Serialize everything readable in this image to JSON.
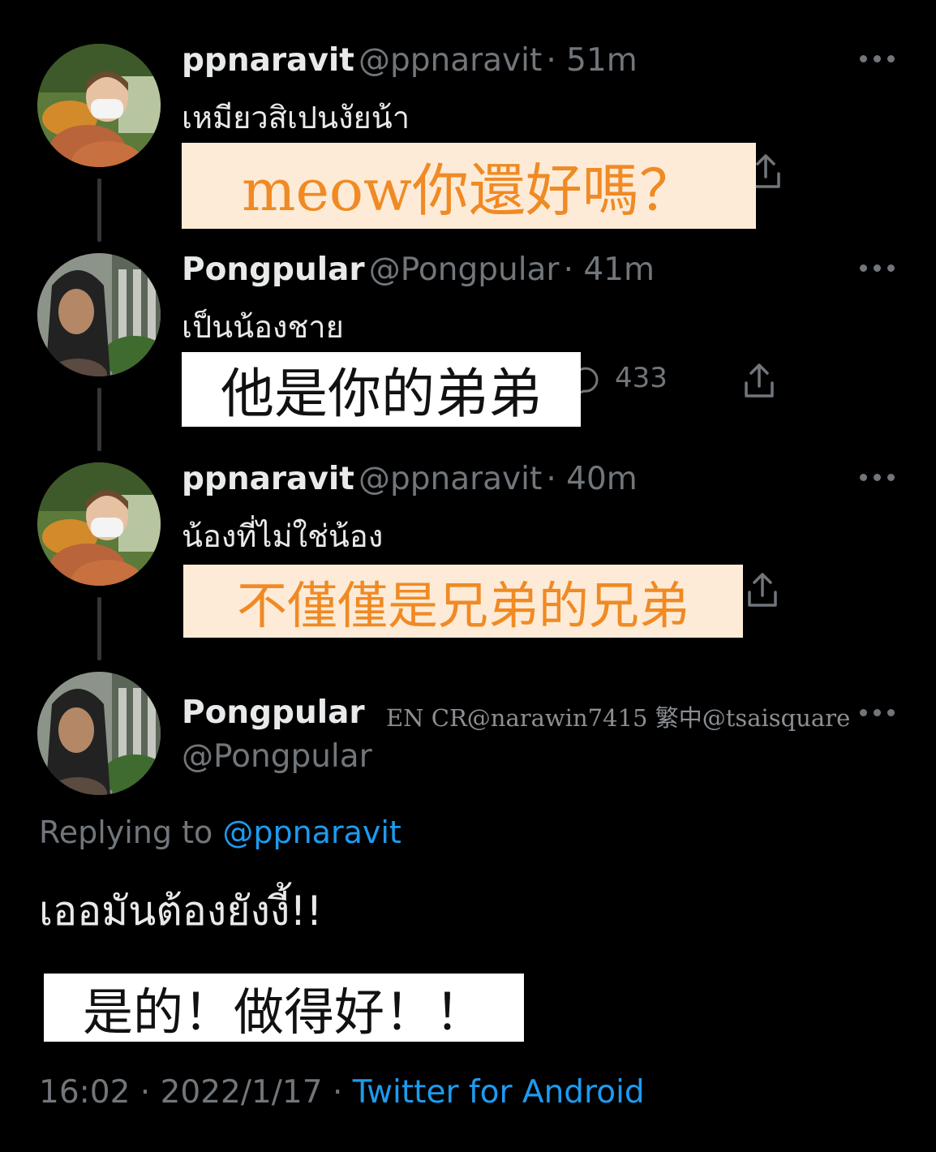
{
  "tweets": [
    {
      "name": "ppnaravit",
      "handle": "@ppnaravit",
      "time": "· 51m",
      "text": "เหมียวสิเปนงัยน้า",
      "subtitle": "meow你還好嗎？"
    },
    {
      "name": "Pongpular",
      "handle": "@Pongpular",
      "time": "· 41m",
      "text": "เป็นน้องชาย",
      "subtitle": "他是你的弟弟",
      "reply_count": "433"
    },
    {
      "name": "ppnaravit",
      "handle": "@ppnaravit",
      "time": "· 40m",
      "text": "น้องที่ไม่ใช่น้อง",
      "subtitle": "不僅僅是兄弟的兄弟"
    }
  ],
  "main_tweet": {
    "name": "Pongpular",
    "handle": "@Pongpular",
    "credit": "EN CR@narawin7415  繁中@tsaisquare",
    "replying_prefix": "Replying to",
    "replying_handle": "@ppnaravit",
    "text": "เออมันต้องยังงี้!!",
    "subtitle": "是的！做得好！！",
    "timestamp": "16:02 · 2022/1/17 ·",
    "source": "Twitter for Android"
  },
  "icons": [
    "more-icon",
    "share-icon",
    "reply-icon"
  ],
  "colors": {
    "background": "#000000",
    "link": "#1d9bf0",
    "muted": "#71767b",
    "subtitle_orange": "#f08a24",
    "subtitle_peach_bg": "#fdebd7"
  }
}
